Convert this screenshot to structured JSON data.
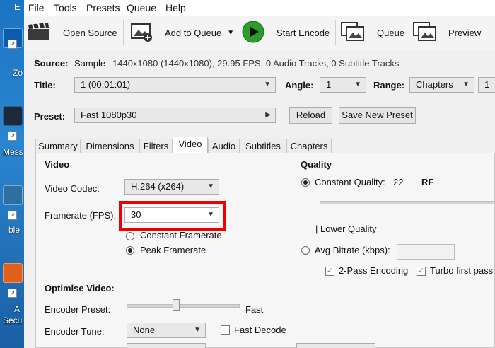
{
  "desktop": {
    "icons": [
      {
        "label": "Zo",
        "name": "zoom"
      },
      {
        "label": "Mess",
        "name": "messenger"
      },
      {
        "label": "ble",
        "name": "app-ble"
      },
      {
        "label": "A",
        "name": "app-a"
      },
      {
        "label": "Secu",
        "name": "security"
      }
    ],
    "top_letter": "E"
  },
  "menu": {
    "items": [
      "File",
      "Tools",
      "Presets",
      "Queue",
      "Help"
    ]
  },
  "toolbar": {
    "open_source": "Open Source",
    "add_to_queue": "Add to Queue",
    "start_encode": "Start Encode",
    "queue": "Queue",
    "preview": "Preview"
  },
  "source": {
    "label": "Source:",
    "name": "Sample",
    "details": "1440x1080 (1440x1080), 29.95 FPS, 0 Audio Tracks, 0 Subtitle Tracks"
  },
  "title_row": {
    "title_label": "Title:",
    "title_value": "1 (00:01:01)",
    "angle_label": "Angle:",
    "angle_value": "1",
    "range_label": "Range:",
    "range_value": "Chapters",
    "range_start": "1"
  },
  "preset": {
    "label": "Preset:",
    "value": "Fast 1080p30",
    "reload": "Reload",
    "save_new": "Save New Preset"
  },
  "tabs": [
    "Summary",
    "Dimensions",
    "Filters",
    "Video",
    "Audio",
    "Subtitles",
    "Chapters"
  ],
  "active_tab": "Video",
  "video": {
    "section": "Video",
    "codec_label": "Video Codec:",
    "codec_value": "H.264 (x264)",
    "framerate_label": "Framerate (FPS):",
    "framerate_value": "30",
    "constant_framerate": "Constant Framerate",
    "peak_framerate": "Peak Framerate"
  },
  "quality": {
    "section": "Quality",
    "constant_quality_label": "Constant Quality:",
    "constant_quality_value": "22",
    "rf": "RF",
    "lower_quality": "| Lower Quality",
    "avg_bitrate_label": "Avg Bitrate (kbps):",
    "two_pass": "2-Pass Encoding",
    "turbo": "Turbo first pass"
  },
  "optimise": {
    "section": "Optimise Video:",
    "encoder_preset_label": "Encoder Preset:",
    "encoder_preset_value": "Fast",
    "encoder_tune_label": "Encoder Tune:",
    "encoder_tune_value": "None",
    "fast_decode": "Fast Decode"
  },
  "colors": {
    "highlight": "#ee0000",
    "start_green": "#2e9b2e"
  }
}
